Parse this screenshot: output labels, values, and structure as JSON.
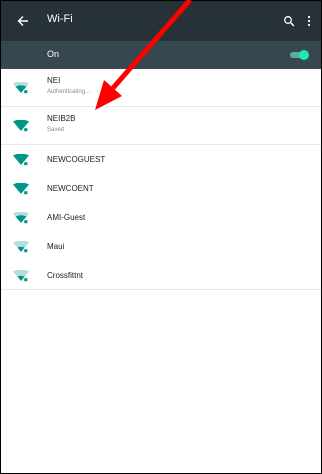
{
  "app": {
    "title": "Wi-Fi",
    "icons": {
      "back": "back-arrow-icon",
      "search": "search-icon",
      "menu": "more-vert-icon"
    }
  },
  "wifi_toggle": {
    "label": "On",
    "state": "on",
    "accent": "#1de9b6"
  },
  "colors": {
    "appbar": "#263238",
    "onbar": "#37474f",
    "signal": "#009688",
    "annotation_arrow": "#ff0000"
  },
  "networks": [
    {
      "ssid": "NEI",
      "status": "Authenticating...",
      "icon": "wifi-signal-icon"
    },
    {
      "ssid": "NEIB2B",
      "status": "Saved",
      "icon": "wifi-signal-icon"
    },
    {
      "ssid": "NEWCOGUEST",
      "status": "",
      "icon": "wifi-signal-icon"
    },
    {
      "ssid": "NEWCOENT",
      "status": "",
      "icon": "wifi-signal-icon"
    },
    {
      "ssid": "AMI-Guest",
      "status": "",
      "icon": "wifi-signal-icon"
    },
    {
      "ssid": "Maui",
      "status": "",
      "icon": "wifi-signal-icon"
    },
    {
      "ssid": "Crossfittnt",
      "status": "",
      "icon": "wifi-signal-icon"
    }
  ]
}
